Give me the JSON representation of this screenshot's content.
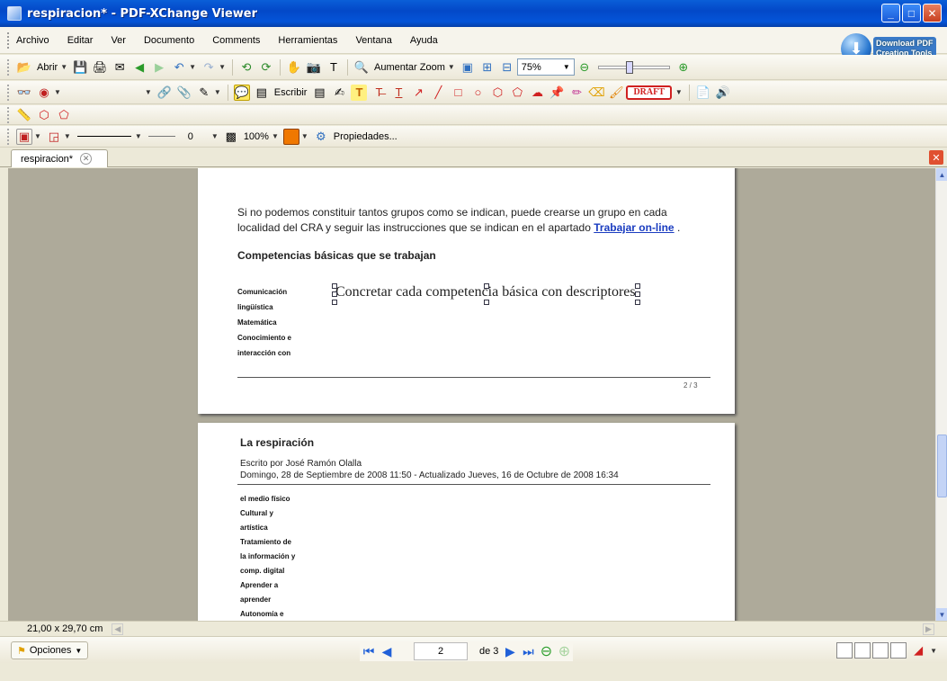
{
  "window": {
    "title": "respiracion* - PDF-XChange Viewer"
  },
  "menu": [
    "Archivo",
    "Editar",
    "Ver",
    "Documento",
    "Comments",
    "Herramientas",
    "Ventana",
    "Ayuda"
  ],
  "promo": {
    "line1": "Download PDF",
    "line2": "Creation Tools"
  },
  "toolbar1": {
    "open_label": "Abrir",
    "zoom_in_label": "Aumentar Zoom",
    "zoom_value": "75%"
  },
  "toolbar2": {
    "write_label": "Escribir",
    "draft_stamp": "DRAFT"
  },
  "toolbar4": {
    "line_width": "0",
    "opacity": "100%",
    "properties_label": "Propiedades..."
  },
  "tab": {
    "label": "respiracion*"
  },
  "page1": {
    "paragraph_1": "Si no podemos constituir tantos grupos como se indican, puede crearse un grupo en cada",
    "paragraph_2": "localidad del CRA y seguir las instrucciones que se indican en el apartado",
    "link": "Trabajar on-line",
    "link_suffix": ".",
    "heading": "Competencias básicas que se trabajan",
    "competencies": [
      "Comunicación",
      "lingüística",
      "Matemática",
      "Conocimiento e",
      "interacción con"
    ],
    "annotation": "Concretar cada competencia básica con descriptores",
    "page_number": "2 / 3"
  },
  "page2": {
    "title": "La respiración",
    "author": "Escrito por José Ramón Olalla",
    "dates": "Domingo, 28 de Septiembre de 2008 11:50 - Actualizado Jueves, 16 de Octubre de 2008 16:34",
    "competencies": [
      "el medio físico",
      "Cultural y",
      "artística",
      "Tratamiento de",
      "la información y",
      "comp. digital",
      "Aprender a",
      "aprender",
      "Autonomía e"
    ]
  },
  "status": {
    "page_size": "21,00 x 29,70 cm"
  },
  "navigation": {
    "options_label": "Opciones",
    "current_page": "2",
    "of_pages": "de 3"
  }
}
